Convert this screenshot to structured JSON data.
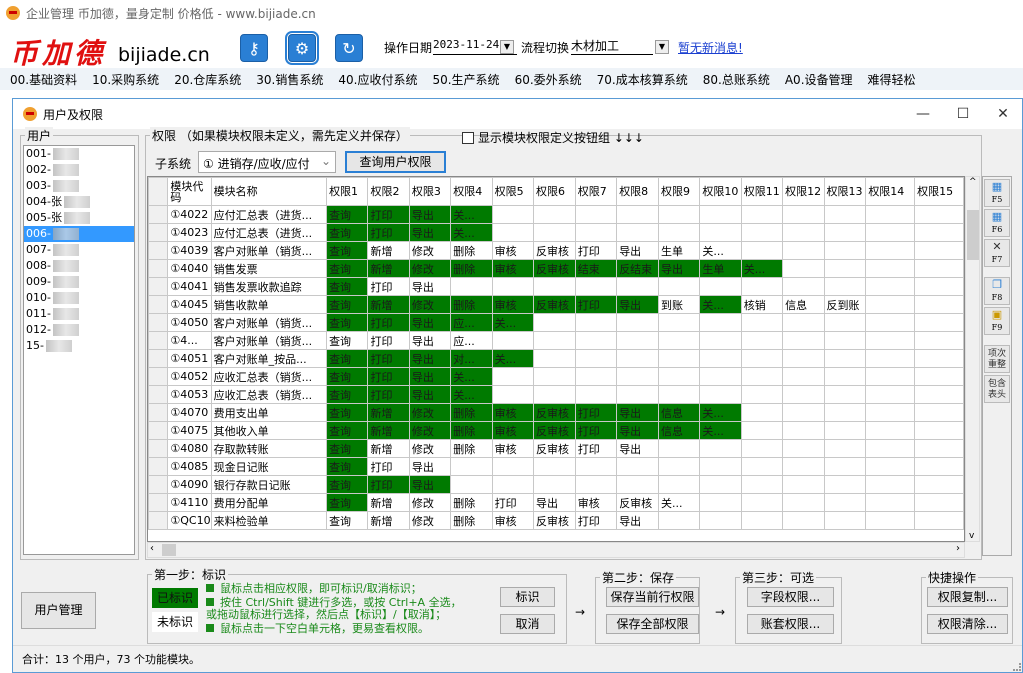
{
  "app": {
    "title": "企业管理 币加德，量身定制 价格低 - www.bijiade.cn",
    "logo_cn": "币加德",
    "logo_en": "bijiade.cn"
  },
  "toolbar": {
    "icons": [
      "key-icon",
      "gear-icon",
      "refresh-icon"
    ],
    "opdate_label": "操作日期",
    "opdate_value": "2023-11-24",
    "flow_label": "流程切换",
    "flow_value": "木材加工",
    "message_link": "暂无新消息!"
  },
  "menu": [
    "00.基础资料",
    "10.采购系统",
    "20.仓库系统",
    "30.销售系统",
    "40.应收付系统",
    "50.生产系统",
    "60.委外系统",
    "70.成本核算系统",
    "80.总账系统",
    "A0.设备管理",
    "难得轻松"
  ],
  "window": {
    "title": "用户及权限",
    "minimize": "—",
    "maximize": "☐",
    "close": "✕"
  },
  "users": {
    "group_title": "用户",
    "items": [
      "001-",
      "002-",
      "003-",
      "004-张",
      "005-张",
      "006-",
      "007-",
      "008-",
      "009-",
      "010-",
      "011-",
      "012-",
      "15-"
    ],
    "selected_index": 5
  },
  "perm": {
    "group_title": "权限  （如果模块权限未定义，需先定义并保存）",
    "show_buttons_label": "显示模块权限定义按钮组 ↓↓↓",
    "show_buttons_checked": false,
    "subsys_label": "子系统",
    "subsys_value": "① 进销存/应收/应付",
    "query_button": "查询用户权限"
  },
  "grid": {
    "headers": [
      "模块代码",
      "模块名称",
      "权限1",
      "权限2",
      "权限3",
      "权限4",
      "权限5",
      "权限6",
      "权限7",
      "权限8",
      "权限9",
      "权限10",
      "权限11",
      "权限12",
      "权限13",
      "权限14",
      "权限15"
    ],
    "rows": [
      {
        "code": "①4022",
        "name": "应付汇总表（进货...",
        "cells": [
          "查询",
          "打印",
          "导出",
          "关..."
        ],
        "on": [
          1,
          1,
          1,
          1
        ]
      },
      {
        "code": "①4023",
        "name": "应付汇总表（进货...",
        "cells": [
          "查询",
          "打印",
          "导出",
          "关..."
        ],
        "on": [
          1,
          1,
          1,
          1
        ]
      },
      {
        "code": "①4039",
        "name": "客户对账单（销货...",
        "cells": [
          "查询",
          "新增",
          "修改",
          "删除",
          "审核",
          "反审核",
          "打印",
          "导出",
          "生单",
          "关..."
        ],
        "on": [
          1,
          0,
          0,
          0,
          0,
          0,
          0,
          0,
          0,
          0
        ]
      },
      {
        "code": "①4040",
        "name": "销售发票",
        "cells": [
          "查询",
          "新增",
          "修改",
          "删除",
          "审核",
          "反审核",
          "结束",
          "反结束",
          "导出",
          "生单",
          "关..."
        ],
        "on": [
          1,
          1,
          1,
          1,
          1,
          1,
          1,
          1,
          1,
          1,
          1
        ]
      },
      {
        "code": "①4041",
        "name": "销售发票收款追踪",
        "cells": [
          "查询",
          "打印",
          "导出"
        ],
        "on": [
          1,
          0,
          0
        ]
      },
      {
        "code": "①4045",
        "name": "销售收款单",
        "cells": [
          "查询",
          "新增",
          "修改",
          "删除",
          "审核",
          "反审核",
          "打印",
          "导出",
          "到账",
          "关...",
          "核销",
          "信息",
          "反到账"
        ],
        "on": [
          1,
          1,
          1,
          1,
          1,
          1,
          1,
          1,
          0,
          1,
          0,
          0,
          0
        ]
      },
      {
        "code": "①4050",
        "name": "客户对账单（销货...",
        "cells": [
          "查询",
          "打印",
          "导出",
          "应...",
          "关..."
        ],
        "on": [
          1,
          1,
          1,
          1,
          1
        ]
      },
      {
        "code": "①4...",
        "name": "客户对账单（销货...",
        "cells": [
          "查询",
          "打印",
          "导出",
          "应..."
        ],
        "on": [
          0,
          0,
          0,
          0
        ]
      },
      {
        "code": "①4051",
        "name": "客户对账单_按品...",
        "cells": [
          "查询",
          "打印",
          "导出",
          "对...",
          "关..."
        ],
        "on": [
          1,
          1,
          1,
          1,
          1
        ]
      },
      {
        "code": "①4052",
        "name": "应收汇总表（销货...",
        "cells": [
          "查询",
          "打印",
          "导出",
          "关..."
        ],
        "on": [
          1,
          1,
          1,
          1
        ]
      },
      {
        "code": "①4053",
        "name": "应收汇总表（销货...",
        "cells": [
          "查询",
          "打印",
          "导出",
          "关..."
        ],
        "on": [
          1,
          1,
          1,
          1
        ]
      },
      {
        "code": "①4070",
        "name": "费用支出单",
        "cells": [
          "查询",
          "新增",
          "修改",
          "删除",
          "审核",
          "反审核",
          "打印",
          "导出",
          "信息",
          "关..."
        ],
        "on": [
          1,
          1,
          1,
          1,
          1,
          1,
          1,
          1,
          1,
          1
        ]
      },
      {
        "code": "①4075",
        "name": "其他收入单",
        "cells": [
          "查询",
          "新增",
          "修改",
          "删除",
          "审核",
          "反审核",
          "打印",
          "导出",
          "信息",
          "关..."
        ],
        "on": [
          1,
          1,
          1,
          1,
          1,
          1,
          1,
          1,
          1,
          1
        ]
      },
      {
        "code": "①4080",
        "name": "存取款转账",
        "cells": [
          "查询",
          "新增",
          "修改",
          "删除",
          "审核",
          "反审核",
          "打印",
          "导出"
        ],
        "on": [
          1,
          0,
          0,
          0,
          0,
          0,
          0,
          0
        ]
      },
      {
        "code": "①4085",
        "name": "现金日记账",
        "cells": [
          "查询",
          "打印",
          "导出"
        ],
        "on": [
          1,
          0,
          0
        ]
      },
      {
        "code": "①4090",
        "name": "银行存款日记账",
        "cells": [
          "查询",
          "打印",
          "导出"
        ],
        "on": [
          1,
          1,
          1
        ]
      },
      {
        "code": "①4110",
        "name": "费用分配单",
        "cells": [
          "查询",
          "新增",
          "修改",
          "删除",
          "打印",
          "导出",
          "审核",
          "反审核",
          "关..."
        ],
        "on": [
          1,
          0,
          0,
          0,
          0,
          0,
          0,
          0,
          0
        ]
      },
      {
        "code": "①QC10",
        "name": "来料检验单",
        "cells": [
          "查询",
          "新增",
          "修改",
          "删除",
          "审核",
          "反审核",
          "打印",
          "导出"
        ],
        "on": [
          0,
          0,
          0,
          0,
          0,
          0,
          0,
          0
        ]
      }
    ]
  },
  "side_buttons": [
    {
      "key": "F5",
      "icon": "insert-row-icon"
    },
    {
      "key": "F6",
      "icon": "append-row-icon"
    },
    {
      "key": "F7",
      "icon": "delete-icon"
    },
    {
      "key": "F8",
      "icon": "copy-icon"
    },
    {
      "key": "F9",
      "icon": "paste-icon"
    },
    {
      "key": "项次重整",
      "icon": ""
    },
    {
      "key": "包含表头",
      "icon": ""
    }
  ],
  "bottom": {
    "user_mgmt": "用户管理",
    "step1_title": "第一步：标识",
    "marked": "已标识",
    "unmarked": "未标识",
    "tips": [
      "鼠标点击相应权限，即可标识/取消标识；",
      "按住 Ctrl/Shift 键进行多选，或按 Ctrl+A 全选，",
      "或拖动鼠标进行选择，然后点【标识】/【取消】；",
      "鼠标点击一下空白单元格，更易查看权限。"
    ],
    "mark_btn": "标识",
    "cancel_btn": "取消",
    "arrow": "→",
    "step2_title": "第二步：保存",
    "save_row": "保存当前行权限",
    "save_all": "保存全部权限",
    "step3_title": "第三步：可选",
    "field_perm": "字段权限...",
    "account_perm": "账套权限...",
    "quick_title": "快捷操作",
    "perm_copy": "权限复制...",
    "perm_clear": "权限清除..."
  },
  "status": "合计：13 个用户，73 个功能模块。",
  "colors": {
    "granted": "#007a00",
    "selected": "#3399ff",
    "link": "#1a3fd0"
  }
}
